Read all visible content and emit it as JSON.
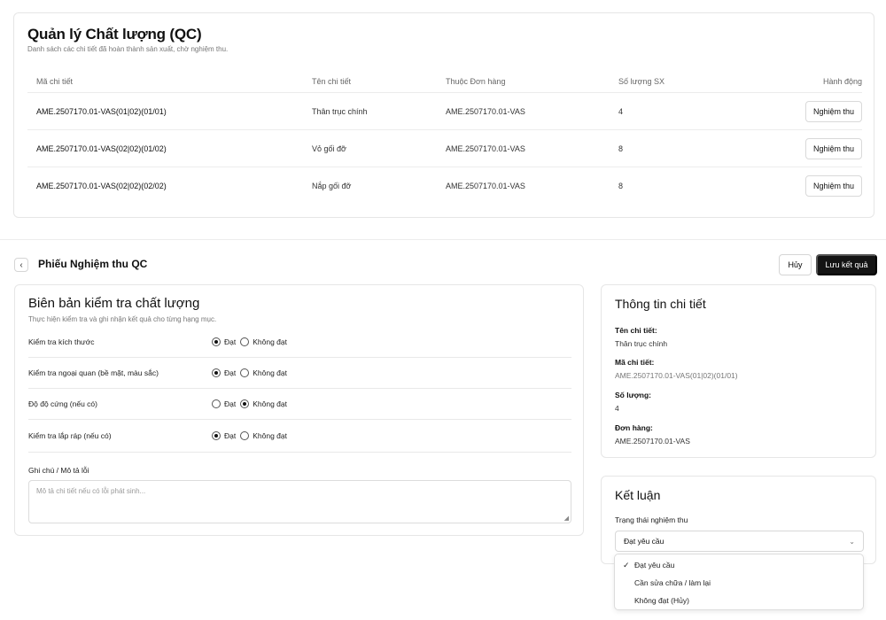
{
  "qc_list": {
    "title": "Quản lý Chất lượng (QC)",
    "subtitle": "Danh sách các chi tiết đã hoàn thành sản xuất, chờ nghiệm thu.",
    "columns": [
      "Mã chi tiết",
      "Tên chi tiết",
      "Thuộc Đơn hàng",
      "Số lượng SX",
      "Hành động"
    ],
    "rows": [
      {
        "code": "AME.2507170.01-VAS(01|02)(01/01)",
        "name": "Thân trục chính",
        "order": "AME.2507170.01-VAS",
        "qty": "4",
        "action": "Nghiệm thu"
      },
      {
        "code": "AME.2507170.01-VAS(02|02)(01/02)",
        "name": "Vỏ gối đỡ",
        "order": "AME.2507170.01-VAS",
        "qty": "8",
        "action": "Nghiệm thu"
      },
      {
        "code": "AME.2507170.01-VAS(02|02)(02/02)",
        "name": "Nắp gối đỡ",
        "order": "AME.2507170.01-VAS",
        "qty": "8",
        "action": "Nghiệm thu"
      }
    ]
  },
  "header": {
    "back_icon": "chevron-left-icon",
    "title": "Phiếu Nghiệm thu QC",
    "cancel_label": "Hủy",
    "save_label": "Lưu kết quả"
  },
  "inspection": {
    "title": "Biên bản kiểm tra chất lượng",
    "subtitle": "Thực hiện kiểm tra và ghi nhận kết quả cho từng hạng mục.",
    "pass_label": "Đạt",
    "fail_label": "Không đạt",
    "items": [
      {
        "label": "Kiểm tra kích thước",
        "result": "pass"
      },
      {
        "label": "Kiểm tra ngoại quan (bề mặt, màu sắc)",
        "result": "pass"
      },
      {
        "label": "Độ độ cứng (nếu có)",
        "result": "fail"
      },
      {
        "label": "Kiểm tra lắp ráp (nếu có)",
        "result": "pass"
      }
    ],
    "note_label": "Ghi chú / Mô tả lỗi",
    "note_placeholder": "Mô tả chi tiết nếu có lỗi phát sinh..."
  },
  "info": {
    "title": "Thông tin chi tiết",
    "name_label": "Tên chi tiết:",
    "name_value": "Thân trục chính",
    "code_label": "Mã chi tiết:",
    "code_value": "AME.2507170.01-VAS(01|02)(01/01)",
    "qty_label": "Số lượng:",
    "qty_value": "4",
    "order_label": "Đơn hàng:",
    "order_value": "AME.2507170.01-VAS"
  },
  "conclusion": {
    "title": "Kết luận",
    "status_label": "Trạng thái nghiệm thu",
    "selected": "Đạt yêu cầu",
    "options": [
      "Đạt yêu cầu",
      "Cần sửa chữa / làm lại",
      "Không đạt (Hủy)"
    ]
  }
}
